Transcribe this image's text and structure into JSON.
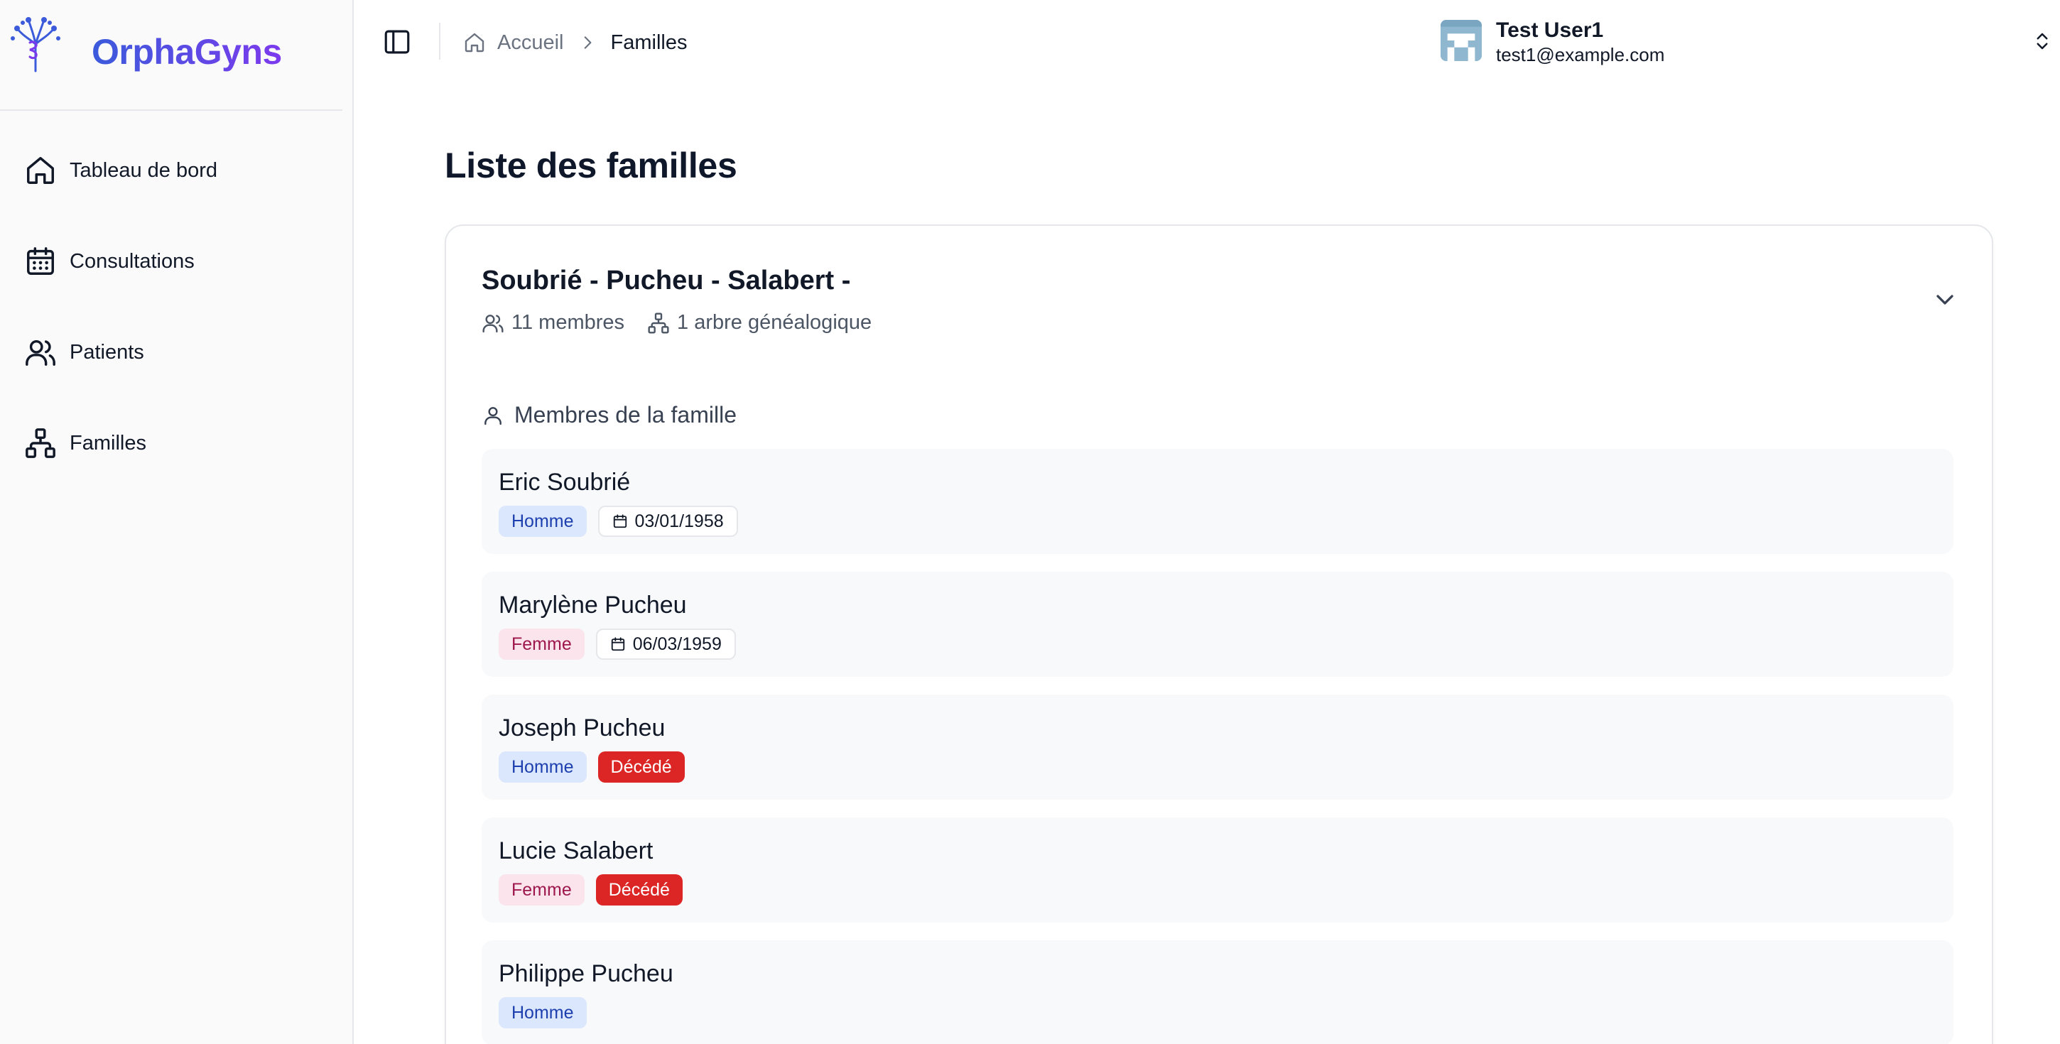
{
  "brand": {
    "name": "OrphaGyns"
  },
  "sidebar": {
    "items": [
      {
        "label": "Tableau de bord",
        "icon": "home-icon"
      },
      {
        "label": "Consultations",
        "icon": "calendar-icon"
      },
      {
        "label": "Patients",
        "icon": "users-icon"
      },
      {
        "label": "Familles",
        "icon": "network-icon"
      }
    ]
  },
  "header": {
    "breadcrumb": {
      "home": "Accueil",
      "current": "Familles"
    },
    "user": {
      "name": "Test User1",
      "email": "test1@example.com"
    }
  },
  "main": {
    "title": "Liste des familles",
    "family": {
      "name": "Soubrié - Pucheu - Salabert -",
      "members_count": "11 membres",
      "trees_count": "1 arbre généalogique",
      "section_title": "Membres de la famille",
      "members": [
        {
          "name": "Eric Soubrié",
          "gender": "Homme",
          "birth": "03/01/1958",
          "deceased": ""
        },
        {
          "name": "Marylène Pucheu",
          "gender": "Femme",
          "birth": "06/03/1959",
          "deceased": ""
        },
        {
          "name": "Joseph Pucheu",
          "gender": "Homme",
          "birth": "",
          "deceased": "Décédé"
        },
        {
          "name": "Lucie Salabert",
          "gender": "Femme",
          "birth": "",
          "deceased": "Décédé"
        },
        {
          "name": "Philippe Pucheu",
          "gender": "Homme",
          "birth": "",
          "deceased": ""
        }
      ]
    }
  },
  "colors": {
    "brand_start": "#3b5bdb",
    "brand_end": "#7c3aed",
    "deceased": "#dc2626",
    "male_bg": "#dbe7fd",
    "female_bg": "#fce4ec"
  }
}
